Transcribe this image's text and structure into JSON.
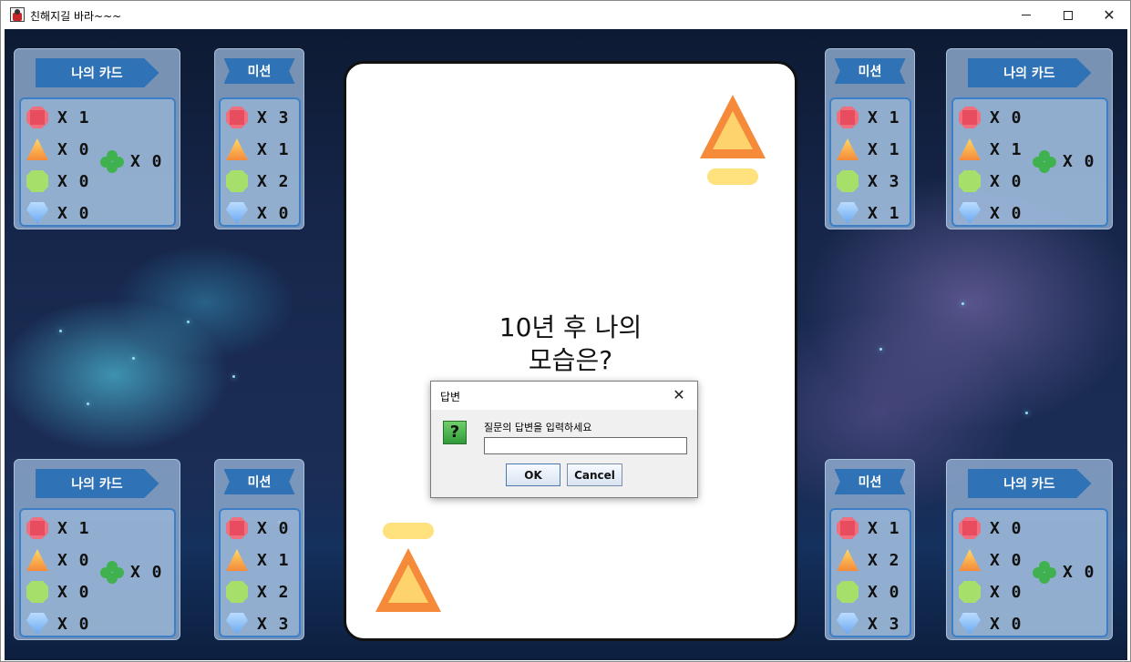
{
  "window": {
    "title": "친해지길 바라~~~",
    "minimize_symbol": "",
    "maximize_symbol": "",
    "close_symbol": "✕"
  },
  "panels": {
    "top_left_player": {
      "label": "나의 카드",
      "ruby": "X 1",
      "topaz": "X 0",
      "emerald": "X 0",
      "diamond": "X 0",
      "clover": "X 0"
    },
    "top_left_mission": {
      "label": "미션",
      "ruby": "X 3",
      "topaz": "X 1",
      "emerald": "X 2",
      "diamond": "X 0"
    },
    "top_right_mission": {
      "label": "미션",
      "ruby": "X 1",
      "topaz": "X 1",
      "emerald": "X 3",
      "diamond": "X 1"
    },
    "top_right_player": {
      "label": "나의 카드",
      "ruby": "X 0",
      "topaz": "X 1",
      "emerald": "X 0",
      "diamond": "X 0",
      "clover": "X 0"
    },
    "bottom_left_player": {
      "label": "나의 카드",
      "ruby": "X 1",
      "topaz": "X 0",
      "emerald": "X 0",
      "diamond": "X 0",
      "clover": "X 0"
    },
    "bottom_left_mission": {
      "label": "미션",
      "ruby": "X 0",
      "topaz": "X 1",
      "emerald": "X 2",
      "diamond": "X 3"
    },
    "bottom_right_mission": {
      "label": "미션",
      "ruby": "X 1",
      "topaz": "X 2",
      "emerald": "X 0",
      "diamond": "X 3"
    },
    "bottom_right_player": {
      "label": "나의 카드",
      "ruby": "X 0",
      "topaz": "X 0",
      "emerald": "X 0",
      "diamond": "X 0",
      "clover": "X 0"
    }
  },
  "card": {
    "question_line1": "10년 후 나의",
    "question_line2": "모습은?",
    "gem_icon": "topaz-icon"
  },
  "dialog": {
    "title": "답변",
    "close_symbol": "✕",
    "icon": "?",
    "message": "질문의 답변을 입력하세요",
    "input_value": "",
    "ok_label": "OK",
    "cancel_label": "Cancel"
  },
  "colors": {
    "banner": "#2f72b5",
    "panel_border": "#3c7fc6",
    "card_border": "#111111",
    "pill": "#ffe27d"
  }
}
